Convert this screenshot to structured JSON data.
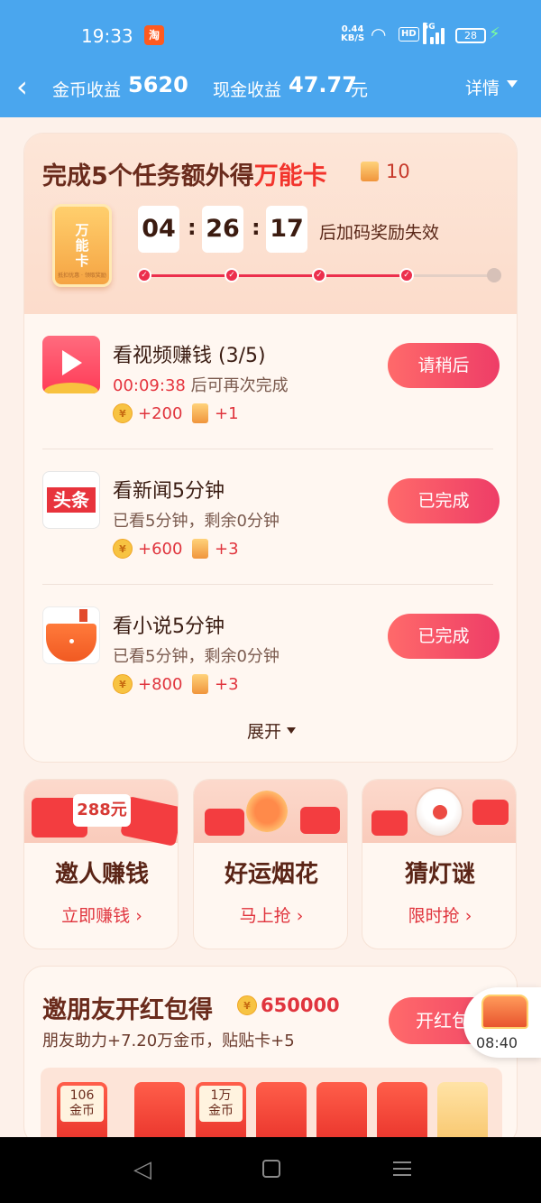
{
  "status_bar": {
    "time": "19:33",
    "app_badge": "淘",
    "net_speed": "0.44",
    "net_unit": "KB/S",
    "hd": "HD",
    "sig_label": "5G",
    "battery": "28"
  },
  "header": {
    "coin_label": "金币收益",
    "coin_value": "5620",
    "cash_label": "现金收益",
    "cash_value": "47.77",
    "cash_unit": "元",
    "detail_label": "详情"
  },
  "task_card": {
    "title_prefix": "完成5个任务额外得",
    "title_highlight": "万能卡",
    "card_count": "10",
    "big_card_text": "万\n能\n卡",
    "big_card_foot": "抵扣优惠 · 领取奖励",
    "timer": {
      "h": "04",
      "m": "26",
      "s": "17"
    },
    "timer_note": "后加码奖励失效",
    "progress": {
      "completed": 4,
      "total": 5
    },
    "tasks": [
      {
        "name": "看视频赚钱 (3/5)",
        "countdown": "00:09:38",
        "sub": " 后可再次完成",
        "coins": "+200",
        "cards": "+1",
        "button": "请稍后",
        "icon": "video-icon"
      },
      {
        "name": "看新闻5分钟",
        "countdown": "",
        "sub": "已看5分钟，剩余0分钟",
        "coins": "+600",
        "cards": "+3",
        "button": "已完成",
        "icon": "news-icon",
        "icon_text": "头条"
      },
      {
        "name": "看小说5分钟",
        "countdown": "",
        "sub": "已看5分钟，剩余0分钟",
        "coins": "+800",
        "cards": "+3",
        "button": "已完成",
        "icon": "novel-icon"
      }
    ],
    "expand_label": "展开"
  },
  "promos": [
    {
      "title": "邀人赚钱",
      "link": "立即赚钱 ›",
      "tag": "288元"
    },
    {
      "title": "好运烟花",
      "link": "马上抢 ›"
    },
    {
      "title": "猜灯谜",
      "link": "限时抢 ›"
    }
  ],
  "invite": {
    "title": "邀朋友开红包得",
    "amount": "650000",
    "desc": "朋友助力+7.20万金币，贴贴卡+5",
    "button": "开红包",
    "packets": [
      {
        "label": "106\n金币"
      },
      {
        "label": ""
      },
      {
        "label": "1万\n金币"
      },
      {
        "label": ""
      },
      {
        "label": ""
      },
      {
        "label": ""
      },
      {
        "label": ""
      }
    ]
  },
  "float_badge": {
    "time": "08:40"
  },
  "colors": {
    "header_bg": "#4aa6ee",
    "accent_red": "#ee3d67",
    "page_bg": "#fdf1ea"
  }
}
